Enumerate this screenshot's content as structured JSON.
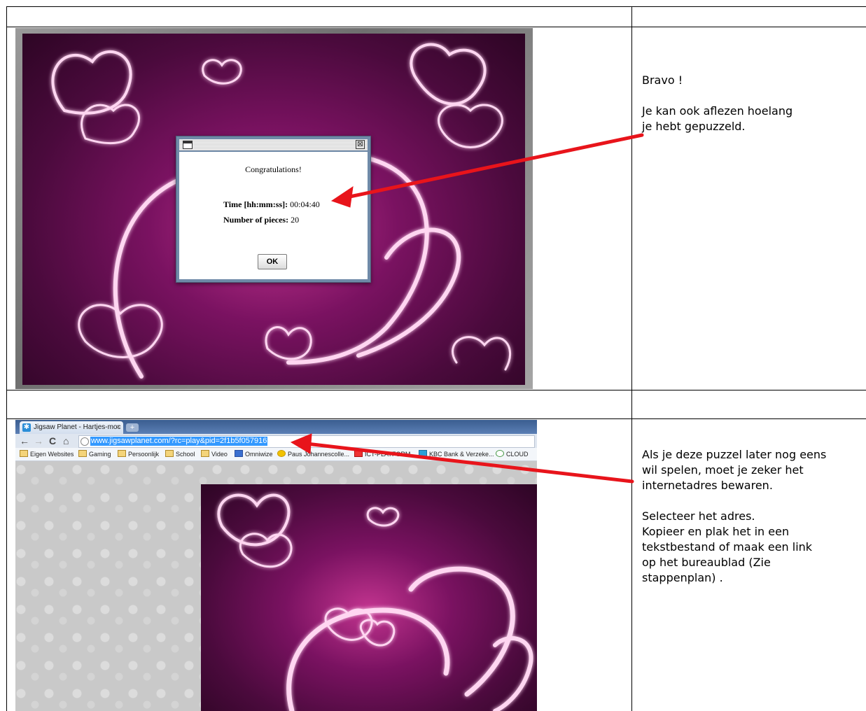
{
  "note1": {
    "line1": "Bravo !",
    "line2": "Je kan ook aflezen hoelang",
    "line3": "je hebt gepuzzeld."
  },
  "dialog": {
    "title": "Congratulations!",
    "time_label": "Time [hh:mm:ss]:",
    "time_value": "00:04:40",
    "pieces_label": "Number of pieces:",
    "pieces_value": "20",
    "ok_label": "OK",
    "close_glyph": "⊠"
  },
  "browser": {
    "tab_title": "Jigsaw Planet - Hartjes-moc",
    "tab_close": "×",
    "new_tab": "+",
    "nav_back": "←",
    "nav_forward": "→",
    "nav_reload": "C",
    "nav_home": "⌂",
    "url": "www.jigsawplanet.com/?rc=play&pid=2f1b5f057916",
    "bookmarks": [
      "Eigen Websites",
      "Gaming",
      "Persoonlijk",
      "School",
      "Video",
      "Omniwize",
      "Paus Johannescolle...",
      "ICT-PLATFORM",
      "KBC Bank & Verzeke...",
      "CLOUD"
    ]
  },
  "note2": {
    "line1": "Als je deze puzzel later nog eens",
    "line2": "wil spelen, moet je zeker het",
    "line3": "internetadres bewaren.",
    "line4": "Selecteer het adres.",
    "line5": "Kopieer en plak het in een",
    "line6": "tekstbestand of maak een link",
    "line7": "op het bureaublad (Zie",
    "line8": "stappenplan) ."
  },
  "colors": {
    "arrow": "#e8141b",
    "puzzle_magenta": "#a8147f",
    "url_highlight": "#3399ff"
  }
}
